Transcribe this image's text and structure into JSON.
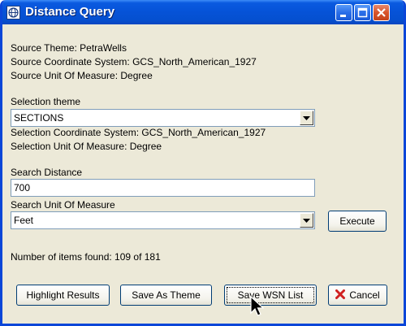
{
  "window": {
    "title": "Distance Query"
  },
  "source": {
    "theme": "Source Theme: PetraWells",
    "coordinate_system": "Source Coordinate System: GCS_North_American_1927",
    "unit_of_measure": "Source Unit Of Measure: Degree"
  },
  "selection": {
    "theme_label": "Selection theme",
    "theme_value": "SECTIONS",
    "coordinate_system": "Selection Coordinate System: GCS_North_American_1927",
    "unit_of_measure": "Selection Unit Of Measure: Degree"
  },
  "search": {
    "distance_label": "Search Distance",
    "distance_value": "700",
    "unit_label": "Search Unit Of Measure",
    "unit_value": "Feet",
    "execute_label": "Execute"
  },
  "results": {
    "count_text": "Number of items found: 109 of 181"
  },
  "buttons": {
    "highlight": "Highlight Results",
    "save_theme": "Save As Theme",
    "save_wsn": "Save WSN List",
    "cancel": "Cancel"
  },
  "colors": {
    "titlebar": "#0653d8",
    "dialog_bg": "#ece9d8",
    "cancel_icon": "#d02020"
  },
  "icons": {
    "app": "globe-icon",
    "minimize": "minimize-icon",
    "maximize": "maximize-icon",
    "close": "close-icon",
    "dropdown": "chevron-down-icon",
    "cancel": "x-icon",
    "cursor": "mouse-pointer-icon"
  }
}
